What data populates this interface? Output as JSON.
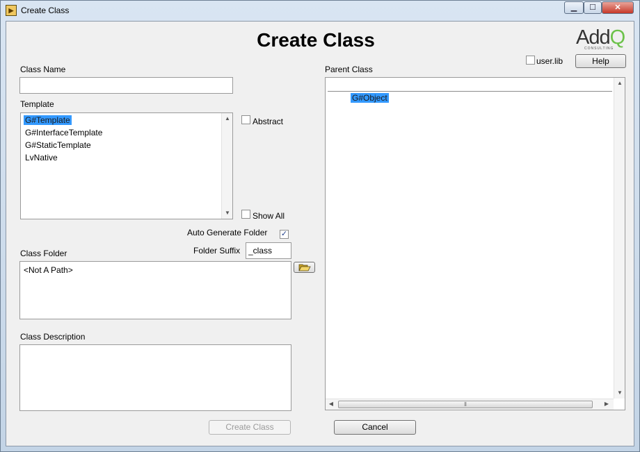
{
  "window": {
    "title": "Create Class",
    "icon": "labview-vi-icon",
    "controls": [
      "minimize-icon",
      "maximize-icon",
      "close-icon"
    ]
  },
  "heading": "Create Class",
  "logo": {
    "main": "Add",
    "q": "Q",
    "sub": "CONSULTING"
  },
  "help_button": "Help",
  "userlib": {
    "label": "user.lib",
    "checked": false
  },
  "class_name": {
    "label": "Class Name",
    "value": ""
  },
  "template": {
    "label": "Template",
    "items": [
      "G#Template",
      "G#InterfaceTemplate",
      "G#StaticTemplate",
      "LvNative"
    ],
    "selected_index": 0
  },
  "abstract": {
    "label": "Abstract",
    "checked": false
  },
  "show_all": {
    "label": "Show All",
    "checked": false
  },
  "auto_generate": {
    "label": "Auto Generate Folder",
    "checked": true,
    "mark": "✓"
  },
  "folder_suffix": {
    "label": "Folder Suffix",
    "value": "_class"
  },
  "class_folder": {
    "label": "Class Folder",
    "value": "<Not A Path>",
    "browse_icon": "folder-open-icon"
  },
  "class_description": {
    "label": "Class Description",
    "value": ""
  },
  "parent_class": {
    "label": "Parent Class",
    "items": [
      "G#Object"
    ],
    "selected_index": 0
  },
  "buttons": {
    "create": "Create Class",
    "cancel": "Cancel"
  },
  "colors": {
    "selection": "#3399ff",
    "logo_accent": "#6cc24a",
    "close_button": "#c7392a"
  }
}
